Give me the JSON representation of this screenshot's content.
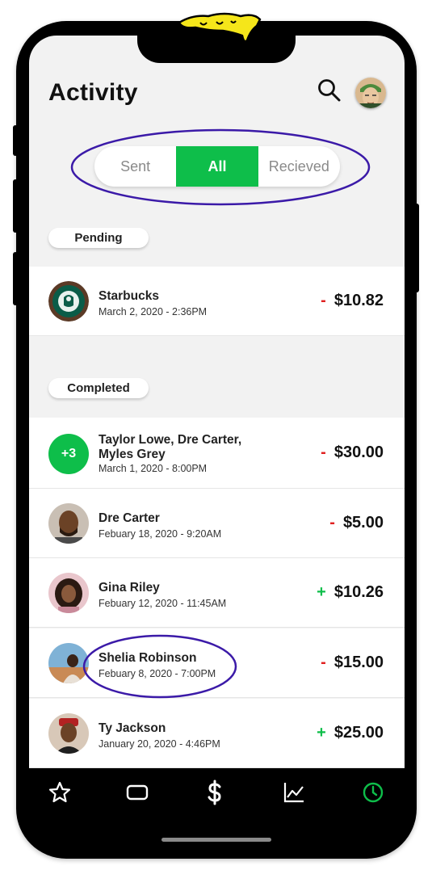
{
  "header": {
    "title": "Activity"
  },
  "segments": {
    "sent": "Sent",
    "all": "All",
    "received": "Recieved"
  },
  "sections": {
    "pending": "Pending",
    "completed": "Completed"
  },
  "pending": [
    {
      "name": "Starbucks",
      "date": "March 2, 2020 - 2:36PM",
      "sign": "-",
      "amount": "$10.82"
    }
  ],
  "completed": [
    {
      "badge": "+3",
      "name_line1": "Taylor Lowe, Dre Carter,",
      "name_line2": "Myles Grey",
      "date": "March 1, 2020 - 8:00PM",
      "sign": "-",
      "amount": "$30.00"
    },
    {
      "name": "Dre Carter",
      "date": "Febuary 18, 2020 - 9:20AM",
      "sign": "-",
      "amount": "$5.00"
    },
    {
      "name": "Gina Riley",
      "date": "Febuary 12, 2020 - 11:45AM",
      "sign": "+",
      "amount": "$10.26"
    },
    {
      "name": "Shelia Robinson",
      "date": "Febuary 8, 2020 - 7:00PM",
      "sign": "-",
      "amount": "$15.00"
    },
    {
      "name": "Ty Jackson",
      "date": "January 20, 2020 - 4:46PM",
      "sign": "+",
      "amount": "$25.00"
    }
  ],
  "tabs": [
    "star-icon",
    "card-icon",
    "dollar-icon",
    "chart-icon",
    "clock-icon"
  ],
  "colors": {
    "accent": "#0ebe4a",
    "negative": "#e02020",
    "annotation": "#3b1aa8"
  }
}
